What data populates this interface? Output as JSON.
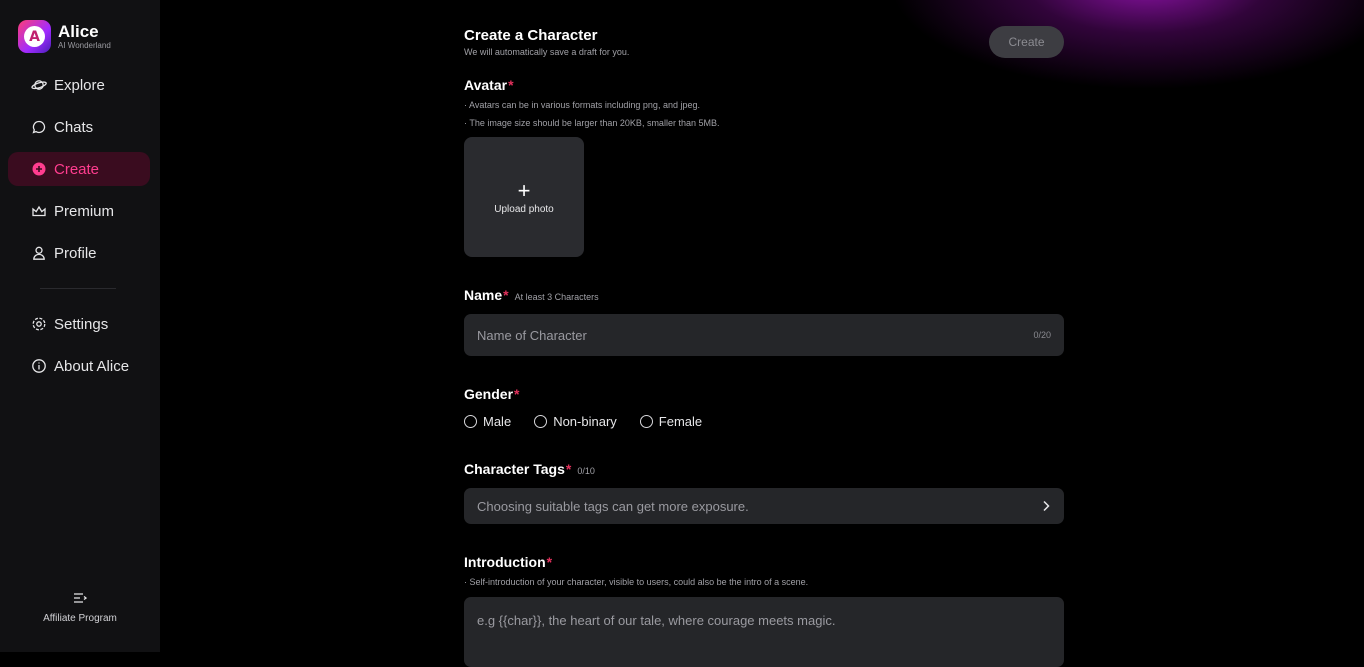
{
  "app": {
    "name": "Alice",
    "tagline": "AI Wonderland"
  },
  "sidebar": {
    "items": [
      {
        "label": "Explore",
        "icon": "planet-icon"
      },
      {
        "label": "Chats",
        "icon": "chat-bubble-icon"
      },
      {
        "label": "Create",
        "icon": "plus-circle-icon",
        "active": true
      },
      {
        "label": "Premium",
        "icon": "crown-icon"
      },
      {
        "label": "Profile",
        "icon": "user-icon"
      }
    ],
    "secondary": [
      {
        "label": "Settings",
        "icon": "gear-icon"
      },
      {
        "label": "About Alice",
        "icon": "info-icon"
      }
    ],
    "affiliate": {
      "label": "Affiliate Program",
      "icon": "list-icon"
    }
  },
  "header": {
    "title": "Create a Character",
    "subtitle": "We will automatically save a draft for you.",
    "create_button": "Create"
  },
  "form": {
    "avatar": {
      "label": "Avatar",
      "notes": [
        "· Avatars can be in various formats including png, and jpeg.",
        "· The image size should be larger than 20KB, smaller than 5MB."
      ],
      "upload_label": "Upload photo",
      "upload_icon": "+"
    },
    "name": {
      "label": "Name",
      "hint": "At least 3 Characters",
      "placeholder": "Name of Character",
      "counter": "0/20"
    },
    "gender": {
      "label": "Gender",
      "options": [
        "Male",
        "Non-binary",
        "Female"
      ]
    },
    "tags": {
      "label": "Character Tags",
      "counter": "0/10",
      "placeholder": "Choosing suitable tags can get more exposure."
    },
    "introduction": {
      "label": "Introduction",
      "note": "· Self-introduction of your character, visible to users, could also be the intro of a scene.",
      "placeholder": "e.g {{char}}, the heart of our tale, where courage meets magic."
    },
    "required_mark": "*"
  },
  "colors": {
    "accent": "#ff3d8f",
    "active_bg": "#3a0c1f",
    "required": "#e2315c",
    "field_bg": "#252629",
    "sidebar_bg": "#111113"
  }
}
